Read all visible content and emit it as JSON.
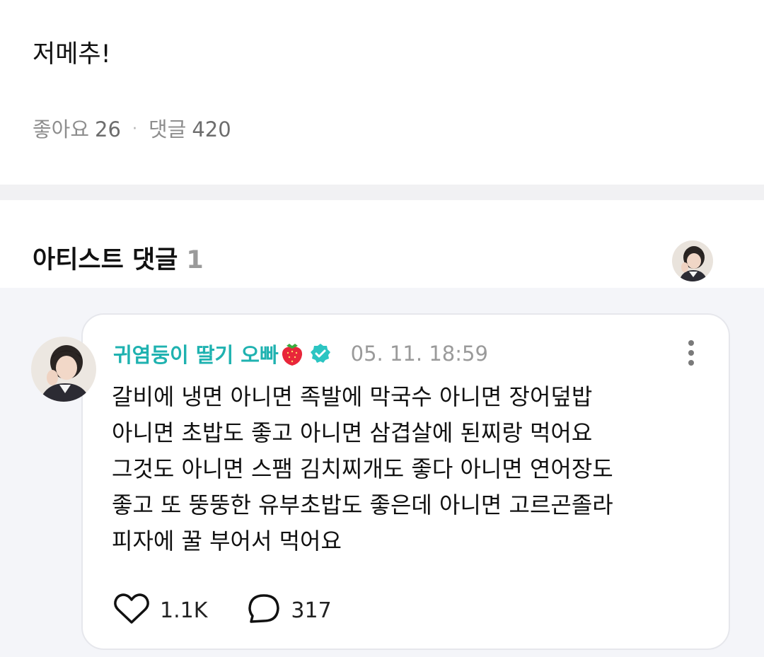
{
  "post": {
    "title": "저메추!",
    "likes_label": "좋아요",
    "likes_count": "26",
    "separator": "·",
    "comments_label": "댓글",
    "comments_count": "420"
  },
  "artist_comments": {
    "heading": "아티스트 댓글",
    "count": "1",
    "avatar_icon": "artist-avatar-icon"
  },
  "comment": {
    "author": "귀염둥이 딸기 오빠",
    "author_emoji": "strawberry-icon",
    "verified_icon": "verified-badge-icon",
    "timestamp": "05. 11. 18:59",
    "body": "갈비에 냉면 아니면 족발에 막국수 아니면 장어덮밥\n아니면 초밥도 좋고 아니면 삼겹살에 된찌랑 먹어요\n그것도 아니면 스팸 김치찌개도 좋다 아니면 연어장도\n좋고 또 뚱뚱한 유부초밥도 좋은데 아니면 고르곤졸라\n피자에 꿀 부어서 먹어요",
    "like_count": "1.1K",
    "reply_count": "317"
  },
  "colors": {
    "accent_teal": "#1fb2b0",
    "muted_text": "#9a9a9a",
    "section_bg": "#f4f5f9"
  }
}
